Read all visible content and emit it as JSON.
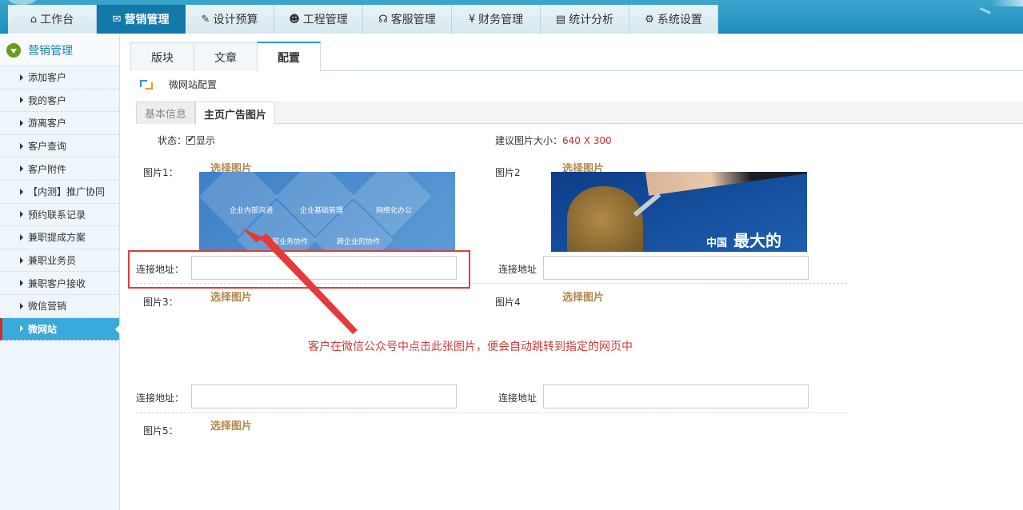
{
  "top_nav": {
    "tabs": [
      {
        "icon": "home-icon",
        "glyph": "⌂",
        "label": "工作台"
      },
      {
        "icon": "chat-icon",
        "glyph": "✉",
        "label": "营销管理"
      },
      {
        "icon": "edit-icon",
        "glyph": "✎",
        "label": "设计预算"
      },
      {
        "icon": "users-icon",
        "glyph": "☻",
        "label": "工程管理"
      },
      {
        "icon": "headset-icon",
        "glyph": "☊",
        "label": "客服管理"
      },
      {
        "icon": "yen-icon",
        "glyph": "¥",
        "label": "财务管理"
      },
      {
        "icon": "chart-icon",
        "glyph": "▤",
        "label": "统计分析"
      },
      {
        "icon": "gear-icon",
        "glyph": "⚙",
        "label": "系统设置"
      }
    ],
    "active_index": 1
  },
  "sidebar": {
    "title": "营销管理",
    "items": [
      {
        "label": "添加客户"
      },
      {
        "label": "我的客户"
      },
      {
        "label": "游离客户"
      },
      {
        "label": "客户查询"
      },
      {
        "label": "客户附件"
      },
      {
        "label": "【内测】推广协同"
      },
      {
        "label": "预约联系记录"
      },
      {
        "label": "兼职提成方案"
      },
      {
        "label": "兼职业务员"
      },
      {
        "label": "兼职客户接收"
      },
      {
        "label": "微信营销"
      },
      {
        "label": "微网站"
      }
    ],
    "active_label": "微网站"
  },
  "tabs": {
    "items": [
      "版块",
      "文章",
      "配置"
    ],
    "active": "配置"
  },
  "breadcrumb": {
    "text": "微网站配置"
  },
  "subtabs": {
    "items": [
      "基本信息",
      "主页广告图片"
    ],
    "active": "主页广告图片"
  },
  "form": {
    "status_label": "状态：",
    "status_checkbox_label": "显示",
    "status_checked": true,
    "size_hint_label": "建议图片大小：",
    "size_hint_value": "640 X 300",
    "pick_label": "选择图片",
    "pictures": [
      {
        "label": "图片1："
      },
      {
        "label": "图片2"
      },
      {
        "label": "图片3："
      },
      {
        "label": "图片4"
      },
      {
        "label": "图片5："
      }
    ],
    "url_label_left": "连接地址：",
    "url_label_right": "连接地址",
    "url_values": [
      "",
      "",
      "",
      ""
    ]
  },
  "banner1": {
    "captions": [
      "企业内部沟通",
      "企业基础管理",
      "网络化办公",
      "内部业务协作",
      "跨企业的协作"
    ]
  },
  "banner2": {
    "small_text": "中国",
    "big_text": "最大的"
  },
  "annotation": {
    "text": "客户在微信公众号中点击此张图片，便会自动跳转到指定的网页中",
    "color": "#d13a3a"
  }
}
